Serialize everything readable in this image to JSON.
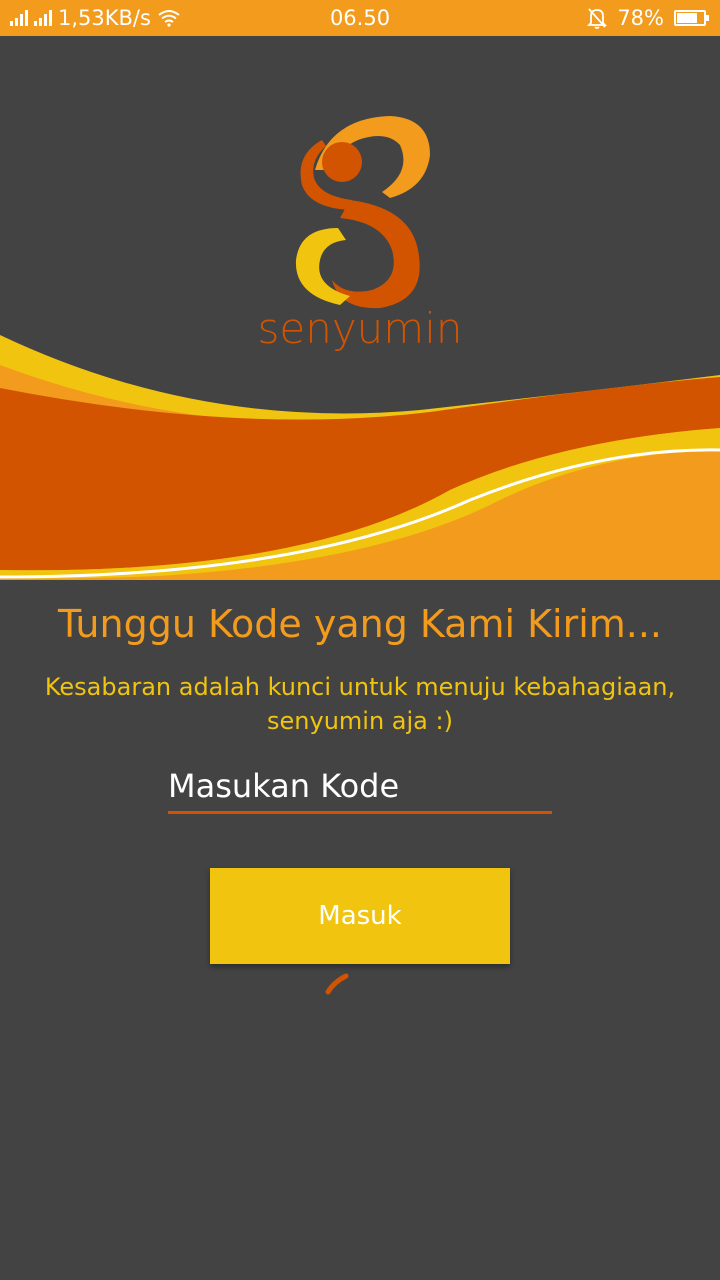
{
  "status_bar": {
    "network_speed": "1,53KB/s",
    "time": "06.50",
    "battery": "78%",
    "battery_level": 0.78,
    "icons": [
      "signal-icon",
      "signal-icon",
      "wifi-icon",
      "mute-icon",
      "battery-icon"
    ]
  },
  "logo": {
    "text": "senyumin"
  },
  "main": {
    "title": "Tunggu Kode yang Kami Kirim...",
    "subtitle": "Kesabaran adalah kunci untuk menuju kebahagiaan, senyumin aja :)",
    "code_input": {
      "placeholder": "Masukan Kode",
      "value": ""
    },
    "login_button_label": "Masuk"
  },
  "colors": {
    "background": "#434343",
    "status_bar": "#f29b1c",
    "orange_dark": "#d35400",
    "orange": "#f29b1c",
    "yellow": "#f1c40f"
  }
}
